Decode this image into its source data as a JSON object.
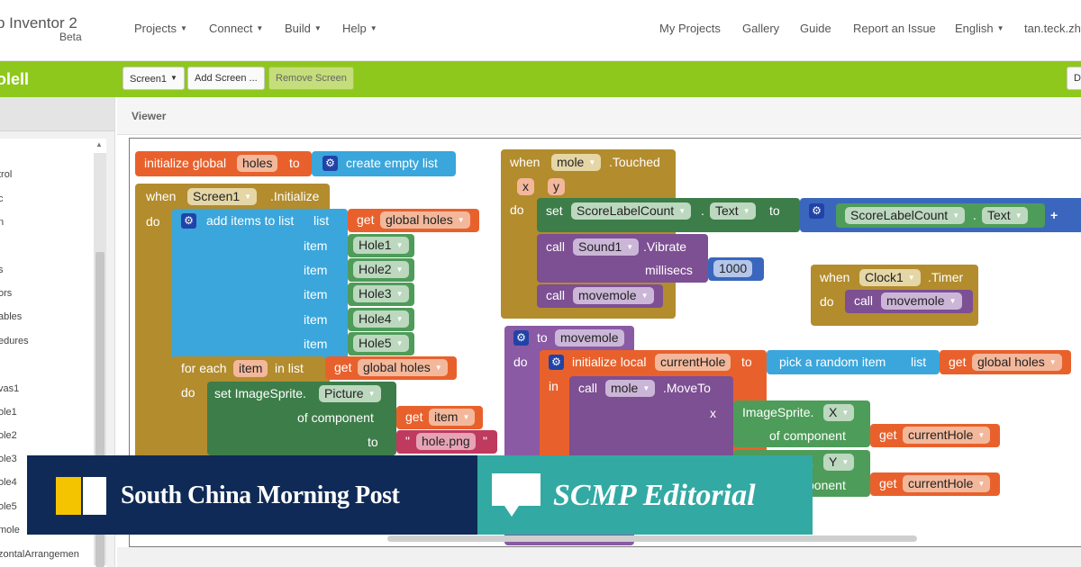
{
  "app": {
    "title": "p Inventor 2",
    "subtitle": "Beta"
  },
  "menu": {
    "projects": "Projects",
    "connect": "Connect",
    "build": "Build",
    "help": "Help",
    "my_projects": "My Projects",
    "gallery": "Gallery",
    "guide": "Guide",
    "report": "Report an Issue",
    "language": "English",
    "user": "tan.teck.zhi"
  },
  "toolbar": {
    "project_name": "olell",
    "screen_select": "Screen1",
    "add_screen": "Add Screen ...",
    "remove_screen": "Remove Screen",
    "right_button": "De"
  },
  "sidebar": {
    "items": [
      "trol",
      "c",
      "n",
      "",
      "s",
      "ors",
      "ables",
      "edures",
      "l",
      "vas1",
      "ole1",
      "ole2",
      "ole3",
      "ole4",
      "ole5",
      "mole",
      "zontalArrangemen"
    ]
  },
  "viewer": {
    "title": "Viewer"
  },
  "blocks": {
    "init_global": "initialize global",
    "holes": "holes",
    "to": "to",
    "create_empty_list": "create empty list",
    "when": "when",
    "screen1": "Screen1",
    "initialize_event": ".Initialize",
    "do": "do",
    "add_items": "add items to list",
    "list": "list",
    "get": "get",
    "global_holes": "global holes",
    "item": "item",
    "hole1": "Hole1",
    "hole2": "Hole2",
    "hole3": "Hole3",
    "hole4": "Hole4",
    "hole5": "Hole5",
    "for_each": "for each",
    "in_list": "in list",
    "set_imagesprite": "set ImageSprite.",
    "picture": "Picture",
    "of_component": "of component",
    "hole_png": "hole.png",
    "quote": "\"",
    "call": "call",
    "movemole": "movemole",
    "mole": "mole",
    "touched": ".Touched",
    "x": "x",
    "y": "y",
    "set": "set",
    "scorelabelcount": "ScoreLabelCount",
    "dot": ".",
    "text": "Text",
    "plus": "+",
    "sound1": "Sound1",
    "vibrate": ".Vibrate",
    "millisecs": "millisecs",
    "vibrate_ms": "1000",
    "clock1": "Clock1",
    "timer": ".Timer",
    "to_proc": "to",
    "init_local": "initialize local",
    "currenthole": "currentHole",
    "in": "in",
    "pick_random": "pick a random item",
    "moveto": ".MoveTo",
    "imagesprite_x": "ImageSprite.",
    "X": "X",
    "Y": "Y"
  },
  "overlay": {
    "left_logo": "South China Morning Post",
    "right_logo": "SCMP Editorial"
  },
  "colors": {
    "green_bar": "#8ec81c",
    "variable": "#e8612c",
    "list": "#3aa6dc",
    "control": "#b38c2e",
    "component": "#3d7d49",
    "call": "#7d4f93",
    "math": "#3a67bd",
    "text": "#c0395f",
    "scmp_navy": "#0f2a56",
    "scmp_teal": "#33a9a3",
    "scmp_yellow": "#f5c400"
  }
}
